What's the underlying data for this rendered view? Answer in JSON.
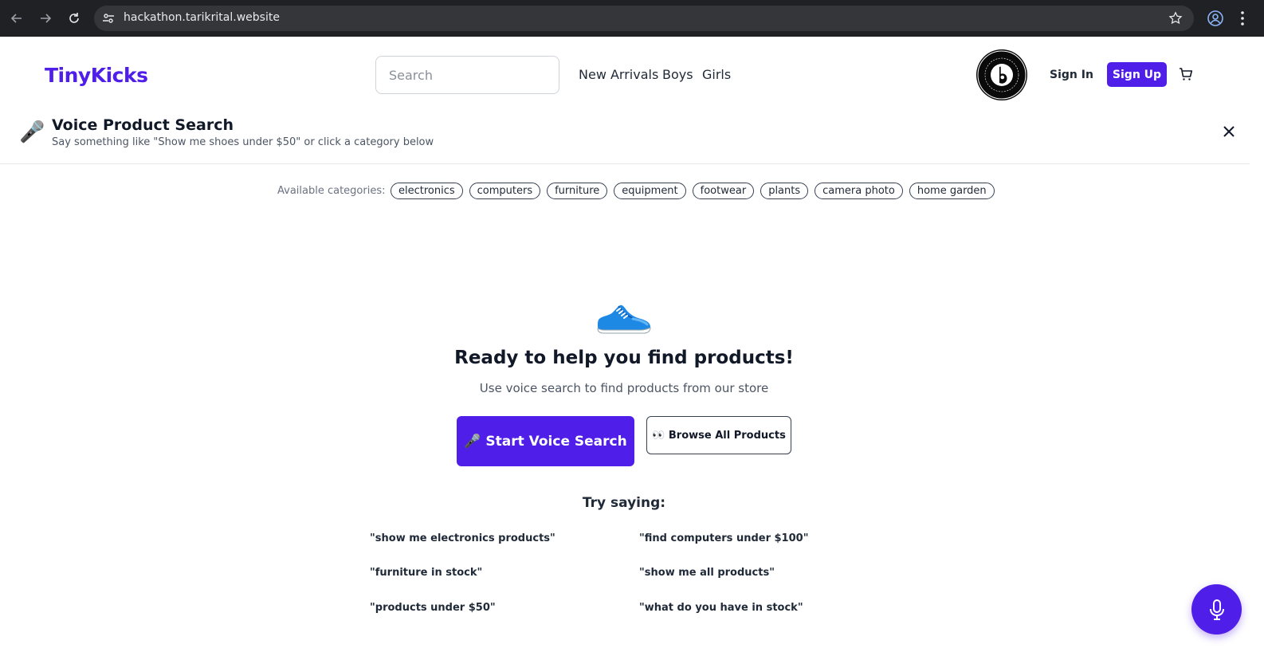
{
  "browser": {
    "url": "hackathon.tarikrital.website"
  },
  "header": {
    "logo": "TinyKicks",
    "search_placeholder": "Search",
    "nav": [
      "New Arrivals",
      "Boys",
      "Girls"
    ],
    "sign_in": "Sign In",
    "sign_up": "Sign Up"
  },
  "voice_banner": {
    "icon": "🎤",
    "title": "Voice Product Search",
    "subtitle": "Say something like \"Show me shoes under $50\" or click a category below"
  },
  "categories": {
    "label": "Available categories:",
    "items": [
      "electronics",
      "computers",
      "furniture",
      "equipment",
      "footwear",
      "plants",
      "camera photo",
      "home garden"
    ]
  },
  "hero": {
    "title": "Ready to help you find products!",
    "subtitle": "Use voice search to find products from our store",
    "voice_button": "🎤 Start Voice Search",
    "browse_button": "👀 Browse All Products"
  },
  "try_saying": {
    "title": "Try saying:",
    "examples": [
      "\"show me electronics products\"",
      "\"find computers under $100\"",
      "\"furniture in stock\"",
      "\"show me all products\"",
      "\"products under $50\"",
      "\"what do you have in stock\""
    ]
  },
  "colors": {
    "brand": "#4f1ee8",
    "chrome": "#202124"
  }
}
